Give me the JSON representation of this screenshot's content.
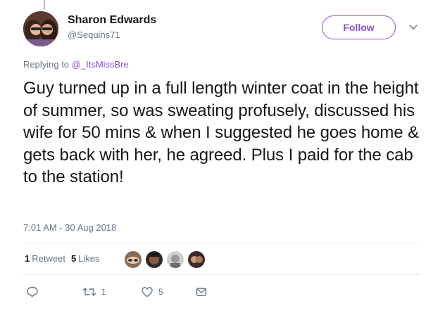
{
  "tweet": {
    "author_name": "Sharon Edwards",
    "author_handle": "@Sequins71",
    "follow_label": "Follow",
    "replying_prefix": "Replying to",
    "replying_to": "@_ItsMissBre",
    "text": "Guy turned up in a full length winter coat in the height of summer, so was sweating profusely, discussed his wife for 50 mins & when I suggested he goes home & gets back with her, he agreed.  Plus I paid for the cab to the station!",
    "timestamp": "7:01 AM - 30 Aug 2018"
  },
  "stats": {
    "retweets_count": "1",
    "retweets_label": "Retweet",
    "likes_count": "5",
    "likes_label": "Likes"
  },
  "actions": {
    "reply_count": "",
    "retweet_count": "1",
    "like_count": "5"
  },
  "colors": {
    "accent": "#8a4dd6",
    "muted": "#657786",
    "text": "#14171a",
    "divider": "#e6ecf0"
  },
  "icons": [
    "chevron-down-icon",
    "reply-icon",
    "retweet-icon",
    "like-icon",
    "message-icon"
  ]
}
